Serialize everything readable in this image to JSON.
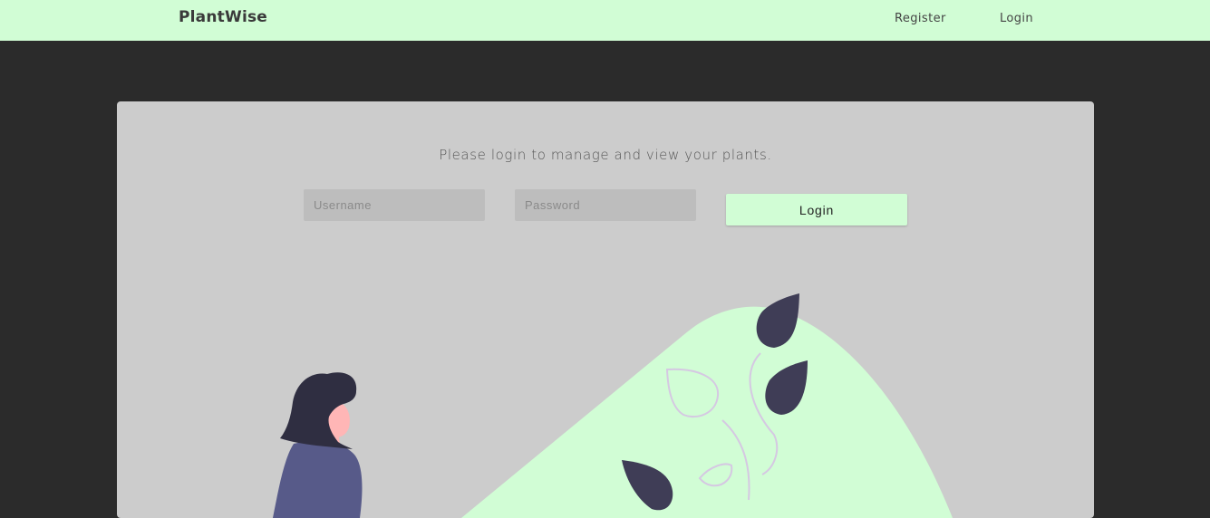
{
  "navbar": {
    "brand": "PlantWise",
    "links": [
      {
        "label": "Register"
      },
      {
        "label": "Login"
      }
    ]
  },
  "main": {
    "tagline": "Please login to manage and view your plants.",
    "form": {
      "username_placeholder": "Username",
      "username_value": "",
      "password_placeholder": "Password",
      "password_value": "",
      "submit_label": "Login"
    }
  },
  "colors": {
    "accent": "#d1fdd5",
    "background": "#2b2b2b",
    "card": "#cccccc",
    "dark_figure": "#3f3d56",
    "shirt": "#575a89",
    "skin": "#ffb6b6"
  }
}
